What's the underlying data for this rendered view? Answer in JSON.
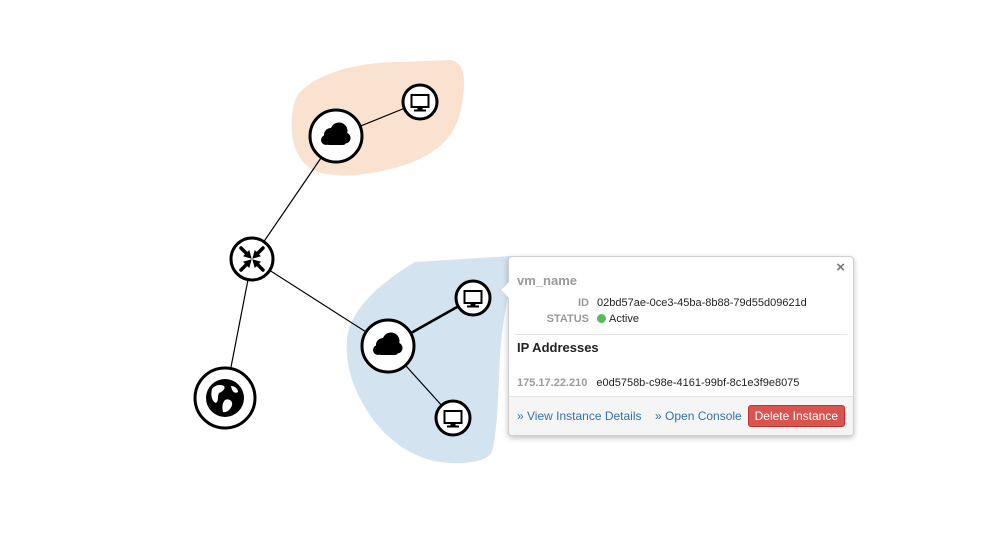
{
  "colors": {
    "network_1_fill": "#fae2d0",
    "network_2_fill": "#d3e3ef",
    "status_active": "#5cb85c",
    "delete_button": "#d9534f",
    "link": "#3072b3"
  },
  "nodes": [
    {
      "name": "network-1-cloud",
      "icon": "cloud-icon"
    },
    {
      "name": "network-1-instance",
      "icon": "monitor-icon"
    },
    {
      "name": "router",
      "icon": "router-arrows-icon"
    },
    {
      "name": "external-network",
      "icon": "globe-icon"
    },
    {
      "name": "network-2-cloud",
      "icon": "cloud-icon"
    },
    {
      "name": "network-2-instance-selected",
      "icon": "monitor-icon"
    },
    {
      "name": "network-2-instance",
      "icon": "monitor-icon"
    }
  ],
  "popup": {
    "close_label": "×",
    "vm_name": "vm_name",
    "id_label": "ID",
    "id_value": "02bd57ae-0ce3-45ba-8b88-79d55d09621d",
    "status_label": "STATUS",
    "status_value": "Active",
    "ip_title": "IP Addresses",
    "ip_address": "175.17.22.210",
    "ip_port_id": "e0d5758b-c98e-4161-99bf-8c1e3f9e8075",
    "view_details_label": "» View Instance Details",
    "open_console_label": "» Open Console",
    "delete_label": "Delete Instance"
  }
}
